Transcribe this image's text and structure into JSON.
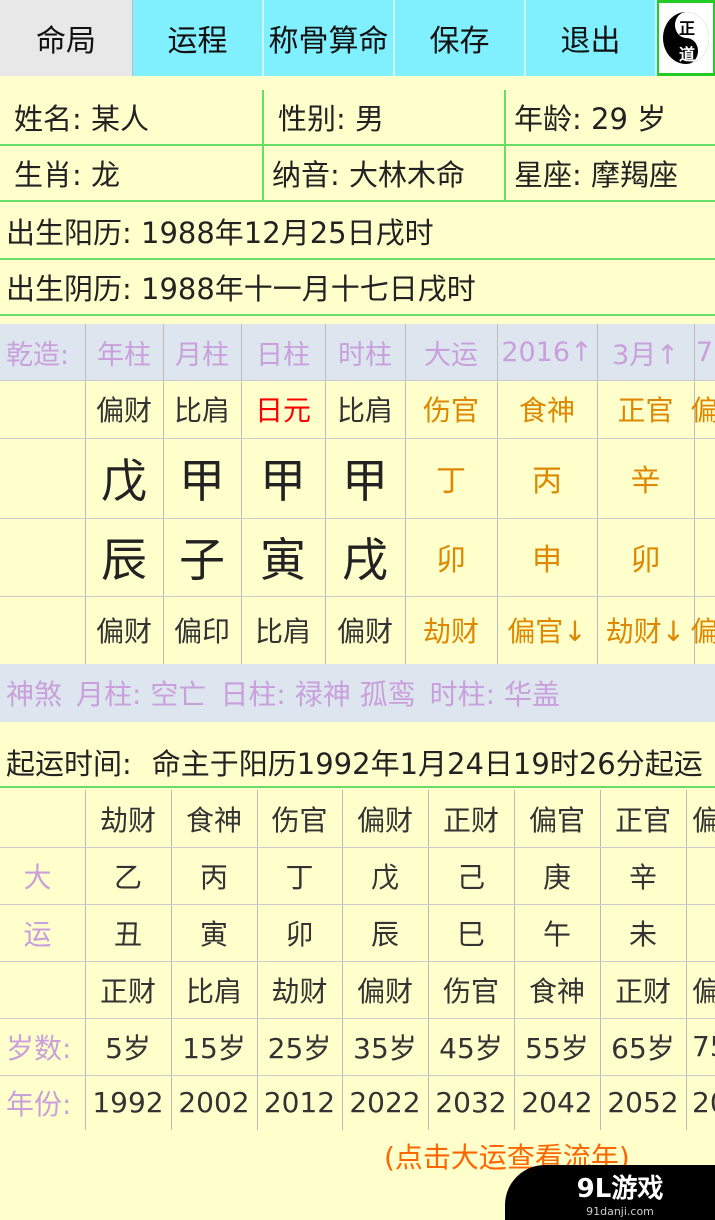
{
  "tabs": [
    "命局",
    "运程",
    "称骨算命",
    "保存",
    "退出"
  ],
  "logo": [
    "正",
    "道"
  ],
  "profile": {
    "name": "姓名: 某人",
    "gender": "性别:  男",
    "age": "年龄: 29 岁",
    "zodiac": "生肖: 龙",
    "nayin": "纳音: 大林木命",
    "star": "星座: 摩羯座",
    "solar": "出生阳历: 1988年12月25日戌时",
    "lunar": "出生阴历: 1988年十一月十七日戌时"
  },
  "chart": {
    "headers": [
      "乾造:",
      "年柱",
      "月柱",
      "日柱",
      "时柱",
      "大运",
      "2016↑",
      "3月↑",
      "7"
    ],
    "top_gods": [
      "偏财",
      "比肩",
      "日元",
      "比肩",
      "伤官",
      "食神",
      "正官",
      "偏"
    ],
    "stems": [
      "戊",
      "甲",
      "甲",
      "甲",
      "丁",
      "丙",
      "辛"
    ],
    "branches": [
      "辰",
      "子",
      "寅",
      "戌",
      "卯",
      "申",
      "卯"
    ],
    "bottom_gods": [
      "偏财",
      "偏印",
      "比肩",
      "偏财",
      "劫财",
      "偏官↓",
      "劫财↓",
      "偏"
    ]
  },
  "shensha": [
    "神煞",
    "月柱: 空亡",
    "日柱: 禄神 孤鸾",
    "时柱: 华盖"
  ],
  "qiyun": {
    "label": "起运时间:",
    "value": "命主于阳历1992年1月24日19时26分起运"
  },
  "dayun": {
    "side_label": [
      "大",
      "运"
    ],
    "top_gods": [
      "劫财",
      "食神",
      "伤官",
      "偏财",
      "正财",
      "偏官",
      "正官",
      "偏"
    ],
    "stems": [
      "乙",
      "丙",
      "丁",
      "戊",
      "己",
      "庚",
      "辛",
      ""
    ],
    "branches": [
      "丑",
      "寅",
      "卯",
      "辰",
      "巳",
      "午",
      "未",
      ""
    ],
    "bottom_gods": [
      "正财",
      "比肩",
      "劫财",
      "偏财",
      "伤官",
      "食神",
      "正财",
      "偏"
    ],
    "age_label": "岁数:",
    "ages": [
      "5岁",
      "15岁",
      "25岁",
      "35岁",
      "45岁",
      "55岁",
      "65岁",
      "75"
    ],
    "year_label": "年份:",
    "years": [
      "1992",
      "2002",
      "2012",
      "2022",
      "2032",
      "2042",
      "2052",
      "20"
    ]
  },
  "hint": "(点击大运查看流年)",
  "watermark": {
    "main": "9L游戏",
    "sub": "91danji.com"
  },
  "colors": {
    "tab_bg": "#80f0ff",
    "page_bg": "#ffffcc",
    "header_bg": "#dde6ee",
    "accent_purple": "#c9a0dc",
    "orange": "#dd8800",
    "red": "#ff0000"
  }
}
